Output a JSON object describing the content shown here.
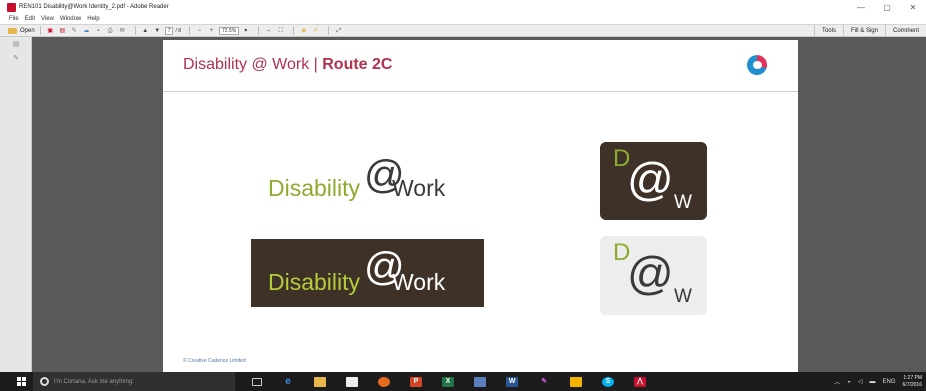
{
  "window": {
    "title": "REN101 Disability@Work Identity_2.pdf - Adobe Reader",
    "controls": {
      "minimize": "—",
      "restore": "▢",
      "close": "✕"
    }
  },
  "menu": [
    "File",
    "Edit",
    "View",
    "Window",
    "Help"
  ],
  "toolbar": {
    "open_label": "Open",
    "page_current": "7",
    "page_total": "/ 8",
    "zoom_value": "72.5%",
    "tools_label": "Tools",
    "fill_sign_label": "Fill & Sign",
    "comment_label": "Comment"
  },
  "document": {
    "title_prefix": "Disability @ Work | ",
    "title_bold": "Route 2C",
    "logo_word": "Disability",
    "logo_at": "@",
    "logo_work": "Work",
    "tile_d": "D",
    "tile_at": "@",
    "tile_w": "W",
    "copyright": "© Creative Cadence Limited"
  },
  "taskbar": {
    "cortana_placeholder": "I'm Cortana. Ask me anything.",
    "tray_lang": "ENG",
    "time": "1:27 PM",
    "date": "6/7/2016"
  },
  "colors": {
    "accent": "#b0324c",
    "brand_green": "#8dab2e",
    "brand_brown": "#3d3128"
  }
}
